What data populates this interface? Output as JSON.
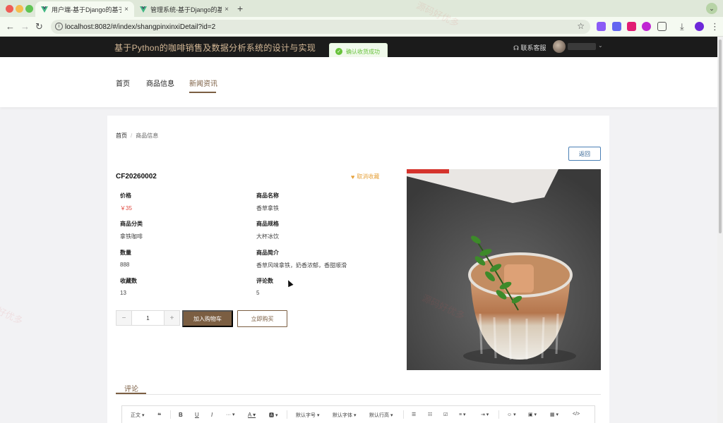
{
  "browser": {
    "tabs": [
      {
        "title": "用户端-基于Django的基于Pyth",
        "active": true
      },
      {
        "title": "管理系统-基于Django的基于Py",
        "active": false
      }
    ],
    "new_tab": "+",
    "url": "localhost:8082/#/index/shangpinxinxiDetail?id=2"
  },
  "header": {
    "site_title": "基于Python的咖啡销售及数据分析系统的设计与实现",
    "support": "联系客服"
  },
  "toast": {
    "message": "确认收货成功"
  },
  "nav": {
    "items": [
      {
        "label": "首页"
      },
      {
        "label": "商品信息"
      },
      {
        "label": "新闻资讯"
      }
    ]
  },
  "breadcrumb": {
    "home": "首页",
    "sep": "/",
    "current": "商品信息"
  },
  "detail": {
    "back": "返回",
    "code": "CF20260002",
    "favorite": "取消收藏",
    "fields": [
      {
        "label": "价格",
        "value": "￥35"
      },
      {
        "label": "商品名称",
        "value": "香草拿铁"
      },
      {
        "label": "商品分类",
        "value": "拿铁咖啡"
      },
      {
        "label": "商品规格",
        "value": "大杯冰饮"
      },
      {
        "label": "数量",
        "value": "888"
      },
      {
        "label": "商品简介",
        "value": "香草风味拿铁，奶香浓郁，香甜顺滑"
      },
      {
        "label": "收藏数",
        "value": "13"
      },
      {
        "label": "评论数",
        "value": "5"
      }
    ],
    "quantity": "1",
    "minus": "−",
    "plus": "+",
    "add_to_cart": "加入购物车",
    "buy_now": "立即购买"
  },
  "comments": {
    "tab": "评论"
  },
  "editor": {
    "paragraph": "正文",
    "font_size": "默认字号",
    "font_family": "默认字体",
    "line_height": "默认行高"
  },
  "watermark": "源码好优多",
  "colors": {
    "accent": "#7b5e42",
    "price": "#e0483f",
    "favorite": "#e6a23c",
    "toast": "#67c23a",
    "header_bg": "#1b1b1b"
  }
}
